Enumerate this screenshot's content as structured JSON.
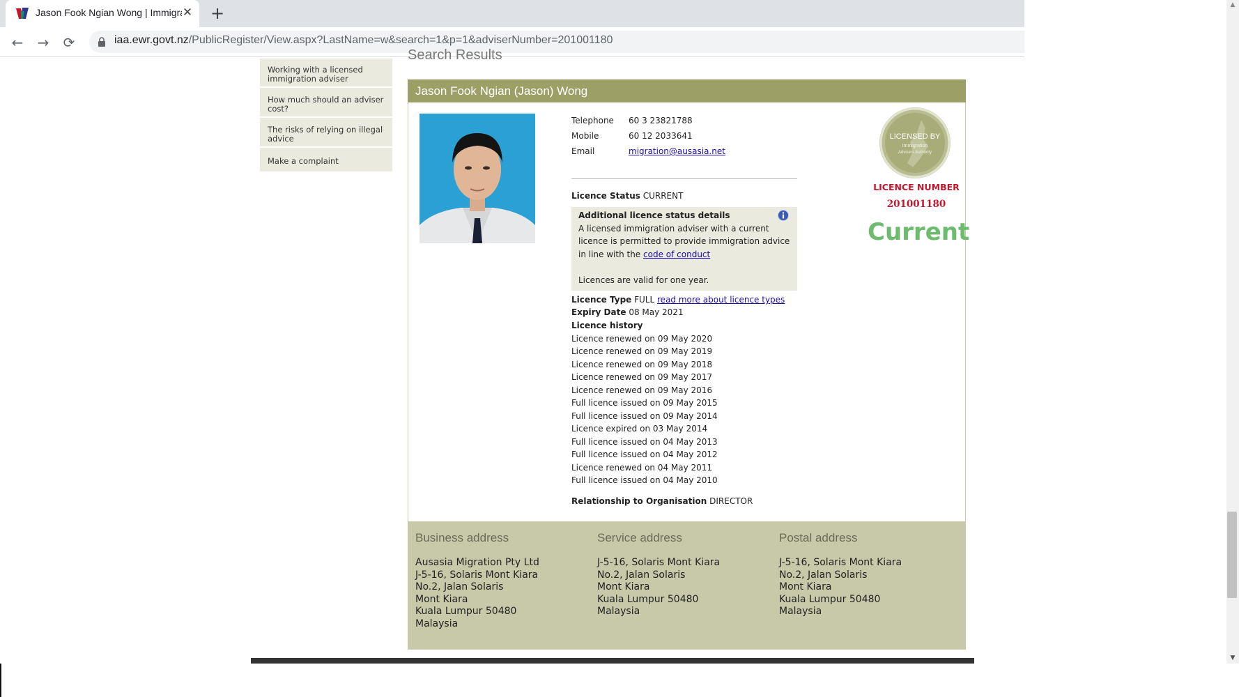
{
  "browser": {
    "tab_title": "Jason Fook Ngian Wong | Immigration Advisers Authority",
    "url_host": "iaa.ewr.govt.nz",
    "url_path": "/PublicRegister/View.aspx?LastName=w&search=1&p=1&adviserNumber=201001180",
    "icons": {
      "back": "arrow-left-icon",
      "forward": "arrow-right-icon",
      "reload": "reload-icon",
      "lock": "lock-icon",
      "close": "close-icon",
      "new_tab": "plus-icon"
    }
  },
  "sidebar": {
    "items": [
      {
        "label": "Working with a licensed immigration adviser"
      },
      {
        "label": "How much should an adviser cost?"
      },
      {
        "label": "The risks of relying on illegal advice"
      },
      {
        "label": "Make a complaint"
      }
    ]
  },
  "main": {
    "heading": "Search Results",
    "adviser_name": "Jason Fook Ngian (Jason) Wong",
    "contact": {
      "telephone_label": "Telephone",
      "telephone": "60 3 23821788",
      "mobile_label": "Mobile",
      "mobile": "60 12 2033641",
      "email_label": "Email",
      "email": "migration@ausasia.net"
    },
    "licence_status_label": "Licence Status",
    "licence_status": "CURRENT",
    "status_details": {
      "title": "Additional licence status details",
      "line1": "A licensed immigration adviser with a current",
      "line2": "licence is permitted to provide immigration advice",
      "line3_prefix": "in line with the",
      "line3_link": "code of conduct",
      "note": "Licences are valid for one year."
    },
    "licence_type_label": "Licence Type",
    "licence_type": "FULL",
    "licence_type_link": "read more about licence types",
    "expiry_label": "Expiry Date",
    "expiry": "08 May 2021",
    "history_label": "Licence history",
    "history": [
      "Licence renewed on 09 May 2020",
      "Licence renewed on 09 May 2019",
      "Licence renewed on 09 May 2018",
      "Licence renewed on 09 May 2017",
      "Licence renewed on 09 May 2016",
      "Full licence issued on 09 May 2015",
      "Full licence issued on 09 May 2014",
      "Licence expired on 03 May 2014",
      "Full licence issued on 04 May 2013",
      "Full licence issued on 04 May 2012",
      "Licence renewed on 04 May 2011",
      "Full licence issued on 04 May 2010"
    ],
    "relationship_label": "Relationship to Organisation",
    "relationship": "DIRECTOR",
    "seal": {
      "line1": "LICENSED BY",
      "line2": "Immigration",
      "line3": "Advisers Authority"
    },
    "licence_number_label": "LICENCE NUMBER",
    "licence_number": "201001180",
    "current_badge": "Current"
  },
  "addresses": {
    "business": {
      "title": "Business address",
      "lines": [
        "Ausasia Migration Pty Ltd",
        "J-5-16, Solaris Mont Kiara",
        "No.2, Jalan Solaris",
        "Mont Kiara",
        "Kuala Lumpur 50480",
        "Malaysia"
      ]
    },
    "service": {
      "title": "Service address",
      "lines": [
        "J-5-16, Solaris Mont Kiara",
        "No.2, Jalan Solaris",
        "Mont Kiara",
        "Kuala Lumpur 50480",
        "Malaysia"
      ]
    },
    "postal": {
      "title": "Postal address",
      "lines": [
        "J-5-16, Solaris Mont Kiara",
        "No.2, Jalan Solaris",
        "Mont Kiara",
        "Kuala Lumpur 50480",
        "Malaysia"
      ]
    }
  },
  "colors": {
    "header_olive": "#9da066",
    "panel_beige": "#eaeade",
    "address_bg": "#c8c9a9",
    "licence_red": "#c4162a",
    "current_green": "#6dbb6d"
  }
}
